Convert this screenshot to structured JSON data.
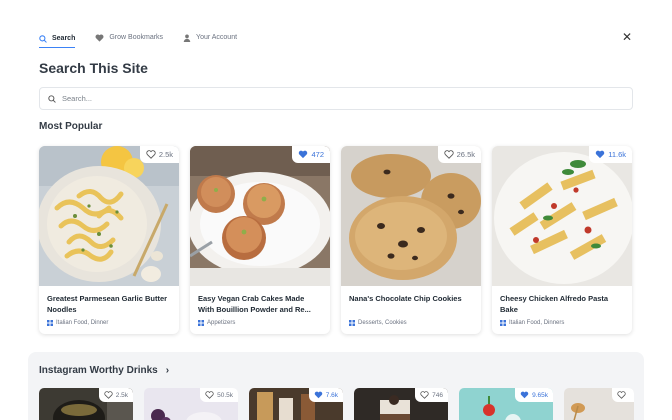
{
  "tabs": [
    {
      "label": "Search",
      "icon": "search-icon",
      "active": true
    },
    {
      "label": "Grow Bookmarks",
      "icon": "heart-icon",
      "active": false
    },
    {
      "label": "Your Account",
      "icon": "user-icon",
      "active": false
    }
  ],
  "close_label": "✕",
  "title": "Search This Site",
  "search": {
    "placeholder": "Search..."
  },
  "most_popular": {
    "title": "Most Popular",
    "cards": [
      {
        "name": "Greatest Parmesean Garlic Butter Noodles",
        "categories": "Italian Food, Dinner",
        "likes": "2.5k",
        "liked": false
      },
      {
        "name": "Easy Vegan Crab Cakes Made With Bouillion Powder and Re...",
        "categories": "Appetizers",
        "likes": "472",
        "liked": true
      },
      {
        "name": "Nana's Chocolate Chip Cookies",
        "categories": "Desserts, Cookies",
        "likes": "26.5k",
        "liked": false
      },
      {
        "name": "Cheesy Chicken Alfredo Pasta Bake",
        "categories": "Italian Food, Dinners",
        "likes": "11.6k",
        "liked": true
      }
    ]
  },
  "drinks": {
    "title": "Instagram Worthy Drinks",
    "items": [
      {
        "likes": "2.5k",
        "liked": false
      },
      {
        "likes": "50.5k",
        "liked": false
      },
      {
        "likes": "7.6k",
        "liked": true
      },
      {
        "likes": "746",
        "liked": false
      },
      {
        "likes": "9.65k",
        "liked": true
      },
      {
        "likes": "",
        "liked": false
      }
    ]
  },
  "colors": {
    "accent": "#3b82f6",
    "liked": "#3b73d9"
  }
}
